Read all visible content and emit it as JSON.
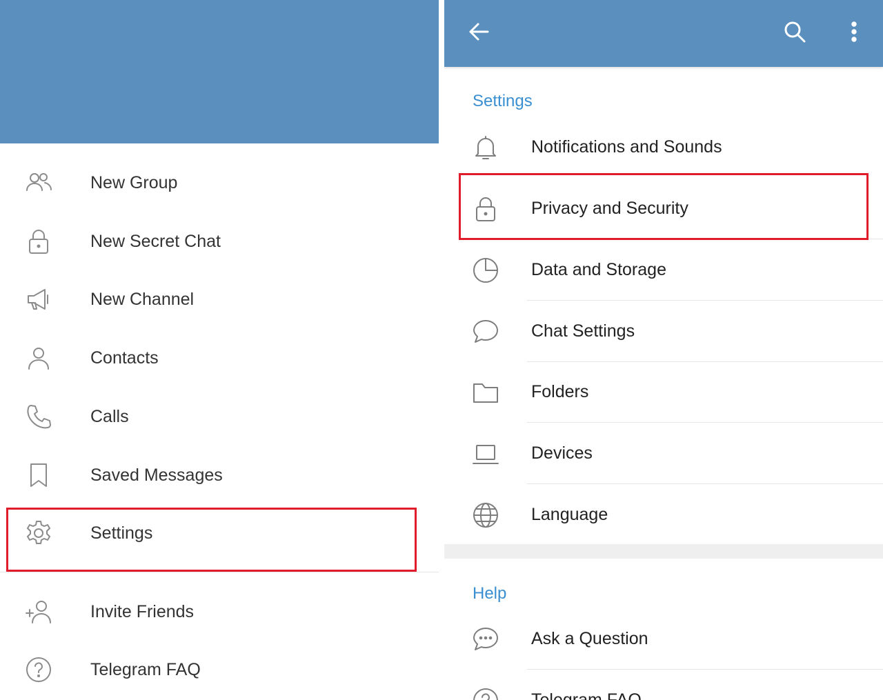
{
  "colors": {
    "header": "#5b8fbd",
    "accent": "#3a8fd1",
    "highlight": "#e11c2a",
    "icon": "#8b8b8b"
  },
  "drawer": {
    "items": [
      {
        "label": "New Group",
        "icon": "group-icon"
      },
      {
        "label": "New Secret Chat",
        "icon": "lock-icon"
      },
      {
        "label": "New Channel",
        "icon": "megaphone-icon"
      },
      {
        "label": "Contacts",
        "icon": "person-icon"
      },
      {
        "label": "Calls",
        "icon": "phone-icon"
      },
      {
        "label": "Saved Messages",
        "icon": "bookmark-icon"
      },
      {
        "label": "Settings",
        "icon": "gear-icon"
      },
      {
        "label": "Invite Friends",
        "icon": "add-person-icon"
      },
      {
        "label": "Telegram FAQ",
        "icon": "question-icon"
      }
    ]
  },
  "settings_screen": {
    "toolbar": {
      "back_icon": "back-arrow-icon",
      "search_icon": "search-icon",
      "more_icon": "more-vertical-icon"
    },
    "settings_section": {
      "title": "Settings",
      "items": [
        {
          "label": "Notifications and Sounds",
          "icon": "bell-icon"
        },
        {
          "label": "Privacy and Security",
          "icon": "lock-icon"
        },
        {
          "label": "Data and Storage",
          "icon": "pie-chart-icon"
        },
        {
          "label": "Chat Settings",
          "icon": "chat-bubble-icon"
        },
        {
          "label": "Folders",
          "icon": "folder-icon"
        },
        {
          "label": "Devices",
          "icon": "laptop-icon"
        },
        {
          "label": "Language",
          "icon": "globe-icon"
        }
      ]
    },
    "help_section": {
      "title": "Help",
      "items": [
        {
          "label": "Ask a Question",
          "icon": "chat-dots-icon"
        },
        {
          "label": "Telegram FAQ",
          "icon": "question-icon"
        }
      ]
    }
  }
}
